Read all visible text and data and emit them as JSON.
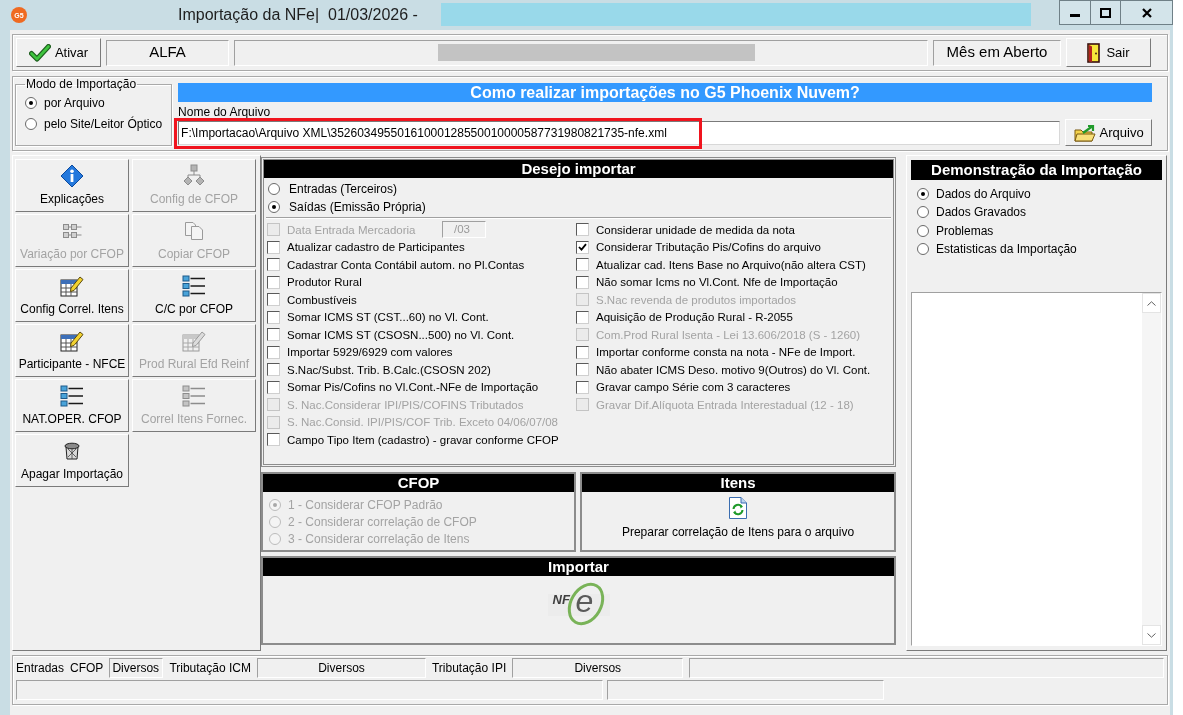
{
  "window": {
    "app_logo": "G5",
    "title": "Importação da NFe|  01/03/2026 -"
  },
  "toolbar": {
    "activate_button": "Ativar",
    "company": "ALFA",
    "period_status": "Mês em Aberto",
    "exit_button": "Sair"
  },
  "import_mode": {
    "title": "Modo de Importação",
    "options": [
      {
        "label": "por Arquivo",
        "selected": true
      },
      {
        "label": "pelo Site/Leitor Óptico",
        "selected": false
      }
    ]
  },
  "help_banner": "Como realizar importações no G5 Phoenix Nuvem?",
  "file": {
    "label": "Nome do Arquivo",
    "value": "F:\\Importacao\\Arquivo XML\\35260349550161000128550010000587731980821735-nfe.xml",
    "highlighted": true,
    "button": "Arquivo"
  },
  "actions": [
    {
      "label": "Explicações",
      "kind": "info",
      "disabled": false
    },
    {
      "label": "Config de CFOP",
      "kind": "hierarchy",
      "disabled": true
    },
    {
      "label": "Variação por CFOP",
      "kind": "grid",
      "disabled": true
    },
    {
      "label": "Copiar CFOP",
      "kind": "copy",
      "disabled": true
    },
    {
      "label": "Config Correl. Itens",
      "kind": "table-edit",
      "disabled": false
    },
    {
      "label": "C/C por CFOP",
      "kind": "list",
      "disabled": false
    },
    {
      "label": "Participante - NFCE",
      "kind": "table-edit",
      "disabled": false
    },
    {
      "label": "Prod Rural Efd Reinf",
      "kind": "table-edit",
      "disabled": true
    },
    {
      "label": "NAT.OPER. CFOP",
      "kind": "list",
      "disabled": false
    },
    {
      "label": "Correl Itens Fornec.",
      "kind": "list",
      "disabled": true
    },
    {
      "label": "Apagar Importação",
      "kind": "trash",
      "disabled": false
    }
  ],
  "import_options": {
    "title": "Desejo importar",
    "direction": [
      {
        "label": "Entradas (Terceiros)",
        "selected": false
      },
      {
        "label": "Saídas (Emissão Própria)",
        "selected": true
      }
    ],
    "left": [
      {
        "kind": "check-field",
        "label": "Data Entrada Mercadoria",
        "value": "/03",
        "checked": false,
        "disabled": true
      },
      {
        "kind": "check",
        "label": "Atualizar cadastro de Participantes",
        "checked": false,
        "disabled": false
      },
      {
        "kind": "check",
        "label": "Cadastrar Conta Contábil autom. no Pl.Contas",
        "checked": false,
        "disabled": false
      },
      {
        "kind": "check",
        "label": "Produtor Rural",
        "checked": false,
        "disabled": false
      },
      {
        "kind": "check",
        "label": "Combustíveis",
        "checked": false,
        "disabled": false
      },
      {
        "kind": "check",
        "label": "Somar ICMS ST (CST...60) no Vl. Cont.",
        "checked": false,
        "disabled": false
      },
      {
        "kind": "check",
        "label": "Somar ICMS ST (CSOSN...500) no Vl. Cont.",
        "checked": false,
        "disabled": false
      },
      {
        "kind": "check",
        "label": "Importar 5929/6929 com valores",
        "checked": false,
        "disabled": false
      },
      {
        "kind": "check",
        "label": "S.Nac/Subst. Trib. B.Calc.(CSOSN 202)",
        "checked": false,
        "disabled": false
      },
      {
        "kind": "check",
        "label": "Somar Pis/Cofins no Vl.Cont.-NFe de Importação",
        "checked": false,
        "disabled": false
      },
      {
        "kind": "check",
        "label": "S. Nac.Considerar IPI/PIS/COFINS Tributados",
        "checked": false,
        "disabled": true
      },
      {
        "kind": "check",
        "label": "S. Nac.Consid. IPI/PIS/COF Trib. Exceto 04/06/07/08",
        "checked": false,
        "disabled": true
      },
      {
        "kind": "check",
        "label": "Campo Tipo Item (cadastro) - gravar conforme CFOP",
        "checked": false,
        "disabled": false
      }
    ],
    "right": [
      {
        "kind": "check",
        "label": "Considerar unidade de medida da nota",
        "checked": false,
        "disabled": false
      },
      {
        "kind": "check",
        "label": "Considerar Tributação Pis/Cofins do arquivo",
        "checked": true,
        "disabled": false
      },
      {
        "kind": "check",
        "label": "Atualizar cad. Itens Base no Arquivo(não altera CST)",
        "checked": false,
        "disabled": false
      },
      {
        "kind": "check",
        "label": "Não somar Icms no Vl.Cont. Nfe de Importação",
        "checked": false,
        "disabled": false
      },
      {
        "kind": "check",
        "label": "S.Nac revenda de produtos importados",
        "checked": false,
        "disabled": true
      },
      {
        "kind": "check",
        "label": "Aquisição de Produção Rural - R-2055",
        "checked": false,
        "disabled": false
      },
      {
        "kind": "check",
        "label": "Com.Prod Rural Isenta - Lei 13.606/2018 (S - 1260)",
        "checked": false,
        "disabled": true
      },
      {
        "kind": "check",
        "label": "Importar conforme consta na nota - NFe de Import.",
        "checked": false,
        "disabled": false
      },
      {
        "kind": "check",
        "label": "Não abater ICMS Deso. motivo 9(Outros) do Vl. Cont.",
        "checked": false,
        "disabled": false
      },
      {
        "kind": "check",
        "label": "Gravar campo Série com 3 caracteres",
        "checked": false,
        "disabled": false
      },
      {
        "kind": "check",
        "label": "Gravar Dif.Alíquota Entrada Interestadual (12 - 18)",
        "checked": false,
        "disabled": true
      }
    ]
  },
  "cfop": {
    "title": "CFOP",
    "options": [
      {
        "label": "1 - Considerar CFOP Padrão",
        "selected": true,
        "disabled": true
      },
      {
        "label": "2 - Considerar correlação de CFOP",
        "selected": false,
        "disabled": true
      },
      {
        "label": "3 - Considerar correlação de Itens",
        "selected": false,
        "disabled": true
      }
    ]
  },
  "items": {
    "title": "Itens",
    "action": "Preparar correlação de Itens para o arquivo"
  },
  "import": {
    "title": "Importar",
    "logo_text": "NF",
    "logo_mark": "e"
  },
  "demonstration": {
    "title": "Demonstração da Importação",
    "views": [
      {
        "label": "Dados do Arquivo",
        "selected": true
      },
      {
        "label": "Dados Gravados",
        "selected": false
      },
      {
        "label": "Problemas",
        "selected": false
      },
      {
        "label": "Estatisticas da Importação",
        "selected": false
      }
    ]
  },
  "status_bar": {
    "row_1": [
      {
        "kind": "label",
        "text": "Entradas"
      },
      {
        "kind": "label",
        "text": "CFOP"
      },
      {
        "kind": "panel",
        "text": "Diversos"
      },
      {
        "kind": "label",
        "text": "Tributação ICM"
      },
      {
        "kind": "panel",
        "text": "Diversos"
      },
      {
        "kind": "label",
        "text": "Tributação IPI"
      },
      {
        "kind": "panel",
        "text": "Diversos"
      }
    ]
  }
}
